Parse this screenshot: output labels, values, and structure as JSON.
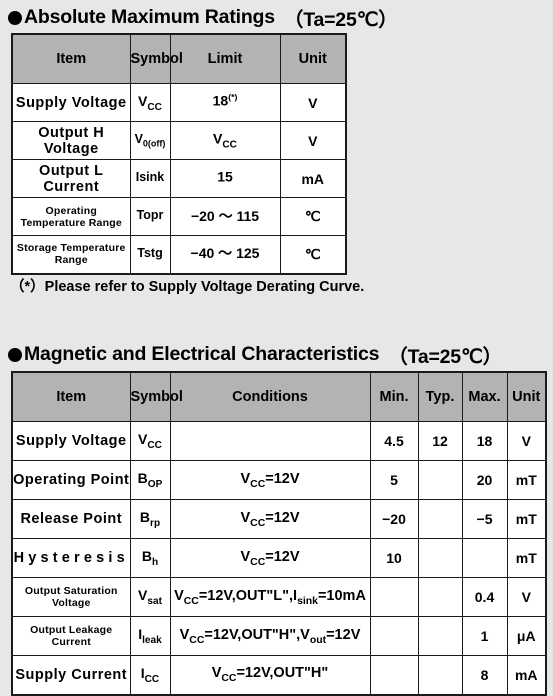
{
  "sections": {
    "absolute_maximum_ratings": {
      "bullet": "filled-circle-bullet",
      "title": "Absolute Maximum Ratings",
      "condition": "（Ta=25℃）",
      "columns": [
        "Item",
        "Symbol",
        "Limit",
        "Unit"
      ],
      "rows": [
        {
          "item": "Supply  Voltage",
          "symbol_base": "V",
          "symbol_sub": "CC",
          "limit_base": "18",
          "limit_sup": "(*)",
          "limit_sub": "",
          "unit": "V"
        },
        {
          "item": "Output H Voltage",
          "symbol_base": "V",
          "symbol_sub": "0(off)",
          "limit_base": "V",
          "limit_sup": "",
          "limit_sub": "CC",
          "unit": "V"
        },
        {
          "item": "Output L Current",
          "symbol_base": "Isink",
          "symbol_sub": "",
          "limit_base": "15",
          "limit_sup": "",
          "limit_sub": "",
          "unit": "mA"
        },
        {
          "item": "Operating  Temperature  Range",
          "symbol_base": "Topr",
          "symbol_sub": "",
          "limit_base": "−20 ～ 115",
          "limit_sup": "",
          "limit_sub": "",
          "unit": "℃"
        },
        {
          "item": "Storage  Temperature  Range",
          "symbol_base": "Tstg",
          "symbol_sub": "",
          "limit_base": "−40 ～ 125",
          "limit_sup": "",
          "limit_sub": "",
          "unit": "℃"
        }
      ],
      "note": "（*）Please refer to Supply Voltage Derating Curve."
    },
    "magnetic_and_electrical_characteristics": {
      "bullet": "filled-circle-bullet",
      "title": "Magnetic and Electrical Characteristics",
      "condition": "（Ta=25℃）",
      "columns": [
        "Item",
        "Symbol",
        "Conditions",
        "Min.",
        "Typ.",
        "Max.",
        "Unit"
      ],
      "rows": [
        {
          "item": "Supply  Voltage",
          "symbol_base": "V",
          "symbol_sub": "CC",
          "cond": "",
          "min": "4.5",
          "typ": "12",
          "max": "18",
          "unit": "V"
        },
        {
          "item": "Operating  Point",
          "symbol_base": "B",
          "symbol_sub": "OP",
          "cond": "Vcc=12V",
          "min": "5",
          "typ": "",
          "max": "20",
          "unit": "mT"
        },
        {
          "item": "Release  Point",
          "symbol_base": "B",
          "symbol_sub": "rp",
          "cond": "Vcc=12V",
          "min": "−20",
          "typ": "",
          "max": "−5",
          "unit": "mT"
        },
        {
          "item": "Hysteresis",
          "symbol_base": "B",
          "symbol_sub": "h",
          "cond": "Vcc=12V",
          "min": "10",
          "typ": "",
          "max": "",
          "unit": "mT"
        },
        {
          "item": "Output  Saturation  Voltage",
          "symbol_base": "V",
          "symbol_sub": "sat",
          "cond": "Vcc=12V,OUT\"L\",Isink=10mA",
          "min": "",
          "typ": "",
          "max": "0.4",
          "unit": "V"
        },
        {
          "item": "Output Leakage Current",
          "symbol_base": "I",
          "symbol_sub": "leak",
          "cond": "Vcc=12V,OUT\"H\",Vout=12V",
          "min": "",
          "typ": "",
          "max": "1",
          "unit": "μA"
        },
        {
          "item": "Supply  Current",
          "symbol_base": "I",
          "symbol_sub": "CC",
          "cond": "Vcc=12V,OUT\"H\"",
          "min": "",
          "typ": "",
          "max": "8",
          "unit": "mA"
        }
      ]
    }
  },
  "colors": {
    "page_background": "#e7e7e7",
    "header_fill": "#b3b3b3",
    "cell_fill": "#ffffff",
    "border": "#1a1a1a",
    "text": "#000000"
  }
}
